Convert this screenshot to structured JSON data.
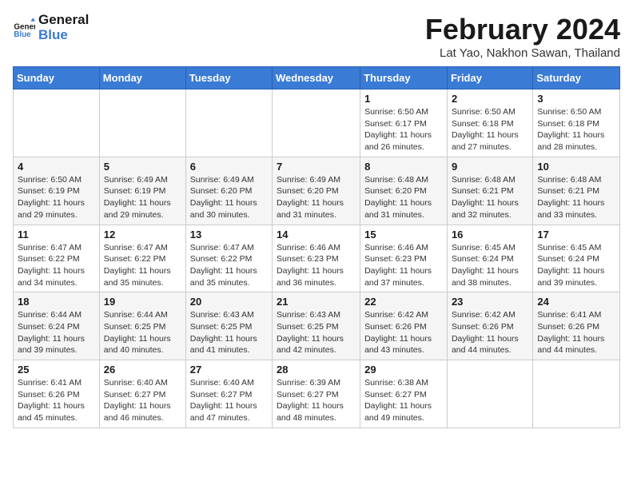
{
  "header": {
    "logo_line1": "General",
    "logo_line2": "Blue",
    "title": "February 2024",
    "subtitle": "Lat Yao, Nakhon Sawan, Thailand"
  },
  "days_of_week": [
    "Sunday",
    "Monday",
    "Tuesday",
    "Wednesday",
    "Thursday",
    "Friday",
    "Saturday"
  ],
  "weeks": [
    [
      {
        "day": "",
        "info": ""
      },
      {
        "day": "",
        "info": ""
      },
      {
        "day": "",
        "info": ""
      },
      {
        "day": "",
        "info": ""
      },
      {
        "day": "1",
        "info": "Sunrise: 6:50 AM\nSunset: 6:17 PM\nDaylight: 11 hours and 26 minutes."
      },
      {
        "day": "2",
        "info": "Sunrise: 6:50 AM\nSunset: 6:18 PM\nDaylight: 11 hours and 27 minutes."
      },
      {
        "day": "3",
        "info": "Sunrise: 6:50 AM\nSunset: 6:18 PM\nDaylight: 11 hours and 28 minutes."
      }
    ],
    [
      {
        "day": "4",
        "info": "Sunrise: 6:50 AM\nSunset: 6:19 PM\nDaylight: 11 hours and 29 minutes."
      },
      {
        "day": "5",
        "info": "Sunrise: 6:49 AM\nSunset: 6:19 PM\nDaylight: 11 hours and 29 minutes."
      },
      {
        "day": "6",
        "info": "Sunrise: 6:49 AM\nSunset: 6:20 PM\nDaylight: 11 hours and 30 minutes."
      },
      {
        "day": "7",
        "info": "Sunrise: 6:49 AM\nSunset: 6:20 PM\nDaylight: 11 hours and 31 minutes."
      },
      {
        "day": "8",
        "info": "Sunrise: 6:48 AM\nSunset: 6:20 PM\nDaylight: 11 hours and 31 minutes."
      },
      {
        "day": "9",
        "info": "Sunrise: 6:48 AM\nSunset: 6:21 PM\nDaylight: 11 hours and 32 minutes."
      },
      {
        "day": "10",
        "info": "Sunrise: 6:48 AM\nSunset: 6:21 PM\nDaylight: 11 hours and 33 minutes."
      }
    ],
    [
      {
        "day": "11",
        "info": "Sunrise: 6:47 AM\nSunset: 6:22 PM\nDaylight: 11 hours and 34 minutes."
      },
      {
        "day": "12",
        "info": "Sunrise: 6:47 AM\nSunset: 6:22 PM\nDaylight: 11 hours and 35 minutes."
      },
      {
        "day": "13",
        "info": "Sunrise: 6:47 AM\nSunset: 6:22 PM\nDaylight: 11 hours and 35 minutes."
      },
      {
        "day": "14",
        "info": "Sunrise: 6:46 AM\nSunset: 6:23 PM\nDaylight: 11 hours and 36 minutes."
      },
      {
        "day": "15",
        "info": "Sunrise: 6:46 AM\nSunset: 6:23 PM\nDaylight: 11 hours and 37 minutes."
      },
      {
        "day": "16",
        "info": "Sunrise: 6:45 AM\nSunset: 6:24 PM\nDaylight: 11 hours and 38 minutes."
      },
      {
        "day": "17",
        "info": "Sunrise: 6:45 AM\nSunset: 6:24 PM\nDaylight: 11 hours and 39 minutes."
      }
    ],
    [
      {
        "day": "18",
        "info": "Sunrise: 6:44 AM\nSunset: 6:24 PM\nDaylight: 11 hours and 39 minutes."
      },
      {
        "day": "19",
        "info": "Sunrise: 6:44 AM\nSunset: 6:25 PM\nDaylight: 11 hours and 40 minutes."
      },
      {
        "day": "20",
        "info": "Sunrise: 6:43 AM\nSunset: 6:25 PM\nDaylight: 11 hours and 41 minutes."
      },
      {
        "day": "21",
        "info": "Sunrise: 6:43 AM\nSunset: 6:25 PM\nDaylight: 11 hours and 42 minutes."
      },
      {
        "day": "22",
        "info": "Sunrise: 6:42 AM\nSunset: 6:26 PM\nDaylight: 11 hours and 43 minutes."
      },
      {
        "day": "23",
        "info": "Sunrise: 6:42 AM\nSunset: 6:26 PM\nDaylight: 11 hours and 44 minutes."
      },
      {
        "day": "24",
        "info": "Sunrise: 6:41 AM\nSunset: 6:26 PM\nDaylight: 11 hours and 44 minutes."
      }
    ],
    [
      {
        "day": "25",
        "info": "Sunrise: 6:41 AM\nSunset: 6:26 PM\nDaylight: 11 hours and 45 minutes."
      },
      {
        "day": "26",
        "info": "Sunrise: 6:40 AM\nSunset: 6:27 PM\nDaylight: 11 hours and 46 minutes."
      },
      {
        "day": "27",
        "info": "Sunrise: 6:40 AM\nSunset: 6:27 PM\nDaylight: 11 hours and 47 minutes."
      },
      {
        "day": "28",
        "info": "Sunrise: 6:39 AM\nSunset: 6:27 PM\nDaylight: 11 hours and 48 minutes."
      },
      {
        "day": "29",
        "info": "Sunrise: 6:38 AM\nSunset: 6:27 PM\nDaylight: 11 hours and 49 minutes."
      },
      {
        "day": "",
        "info": ""
      },
      {
        "day": "",
        "info": ""
      }
    ]
  ]
}
